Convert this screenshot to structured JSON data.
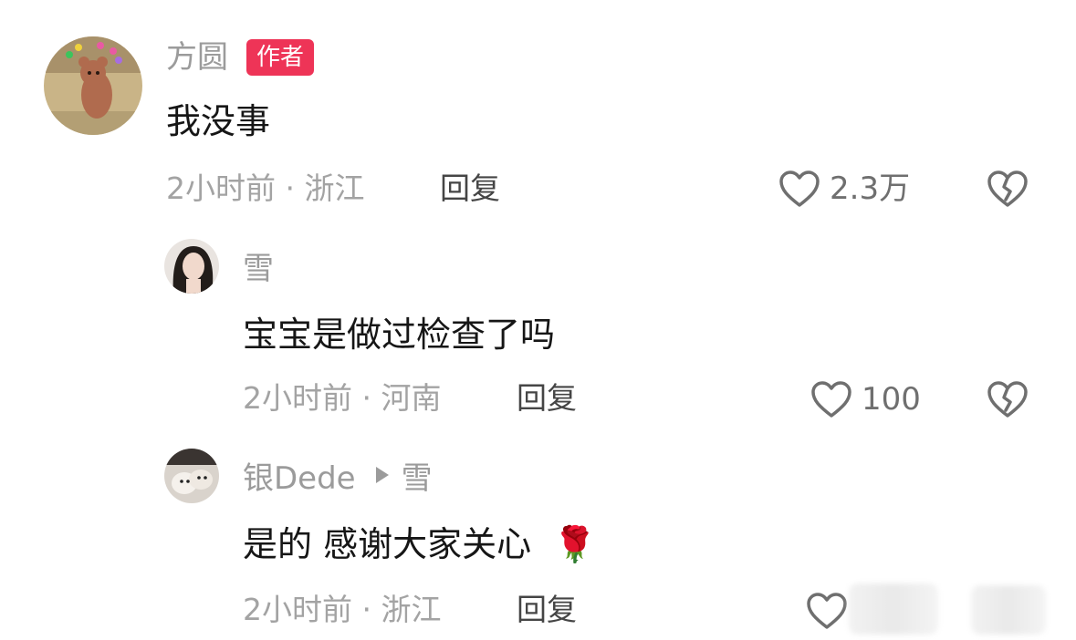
{
  "comments": [
    {
      "user": "方圆",
      "badge": "作者",
      "text": "我没事",
      "time_location": "2小时前 · 浙江",
      "reply_label": "回复",
      "likes": "2.3万",
      "avatar_icon": "cartoon-bear-avatar-icon"
    },
    {
      "user": "雪",
      "text": "宝宝是做过检查了吗",
      "time_location": "2小时前 · 河南",
      "reply_label": "回复",
      "likes": "100",
      "avatar_icon": "portrait-avatar-icon"
    },
    {
      "user": "银Dede",
      "reply_to": "雪",
      "text": "是的 感谢大家关心",
      "emoji": "🌹",
      "time_location": "2小时前 · 浙江",
      "reply_label": "回复",
      "avatar_icon": "puppy-avatar-icon"
    }
  ],
  "colors": {
    "badge": "#ee3457",
    "meta_text": "#a3a3a3",
    "icon_stroke": "#6f6f6f"
  }
}
